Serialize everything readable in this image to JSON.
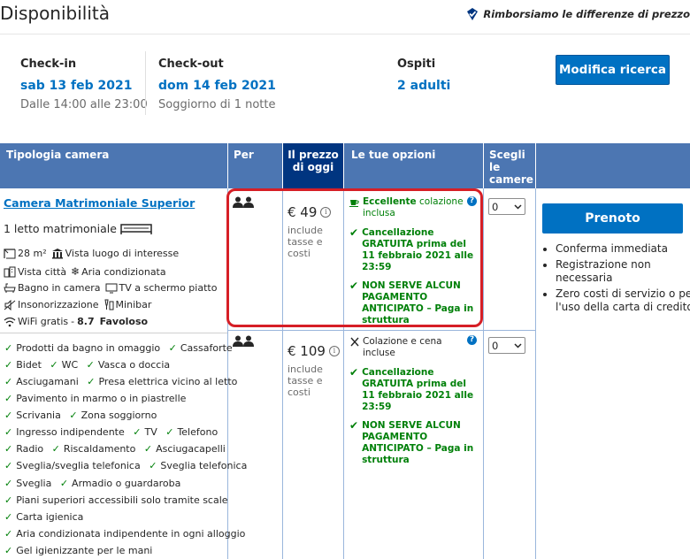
{
  "header": {
    "title": "Disponibilità",
    "promo": "Rimborsiamo le differenze di prezzo"
  },
  "stay": {
    "checkin_label": "Check-in",
    "checkin_date": "sab 13 feb 2021",
    "checkin_time": "Dalle 14:00 alle 23:00",
    "checkout_label": "Check-out",
    "checkout_date": "dom 14 feb 2021",
    "checkout_note": "Soggiorno di 1 notte",
    "guests_label": "Ospiti",
    "guests_value": "2 adulti",
    "modify_button": "Modifica ricerca"
  },
  "table": {
    "headers": {
      "type": "Tipologia camera",
      "per": "Per",
      "price_l1": "Il prezzo",
      "price_l2": "di oggi",
      "options": "Le tue opzioni",
      "choose_l1": "Scegli",
      "choose_l2": "le",
      "choose_l3": "camere"
    }
  },
  "room": {
    "name": "Camera Matrimoniale Superior",
    "bed": "1 letto matrimoniale",
    "facilities": {
      "size": "28 m²",
      "landmark_view": "Vista luogo di interesse",
      "city_view": "Vista città",
      "ac": "Aria condizionata",
      "bathroom": "Bagno in camera",
      "tv": "TV a schermo piatto",
      "soundproof": "Insonorizzazione",
      "minibar": "Minibar",
      "wifi": "WiFi gratis",
      "wifi_score": "8.7",
      "wifi_rating": "Favoloso"
    },
    "amenities": {
      "r1a": "Prodotti da bagno in omaggio",
      "r1b": "Cassaforte",
      "r2a": "Bidet",
      "r2b": "WC",
      "r2c": "Vasca o doccia",
      "r3a": "Asciugamani",
      "r3b": "Presa elettrica vicino al letto",
      "r4a": "Pavimento in marmo o in piastrelle",
      "r5a": "Scrivania",
      "r5b": "Zona soggiorno",
      "r6a": "Ingresso indipendente",
      "r6b": "TV",
      "r6c": "Telefono",
      "r7a": "Radio",
      "r7b": "Riscaldamento",
      "r7c": "Asciugacapelli",
      "r8a": "Sveglia/sveglia telefonica",
      "r8b": "Sveglia telefonica",
      "r9a": "Sveglia",
      "r9b": "Armadio o guardaroba",
      "r10a": "Piani superiori accessibili solo tramite scale",
      "r11a": "Carta igienica",
      "r12a": "Aria condizionata indipendente in ogni alloggio",
      "r13a": "Gel igienizzante per le mani"
    }
  },
  "offers": [
    {
      "price": "€ 49",
      "note_l1": "include",
      "note_l2": "tasse e",
      "note_l3": "costi",
      "meal_bold": "Eccellente",
      "meal_rest": " colazione",
      "meal_l2": "inclusa",
      "cancel_l1": "Cancellazione",
      "cancel_l2": "GRATUITA prima del",
      "cancel_l3": "11 febbraio 2021 alle",
      "cancel_l4": "23:59",
      "prepay_l1": "NON SERVE ALCUN",
      "prepay_l2": "PAGAMENTO",
      "prepay_l3": "ANTICIPATO – Paga in",
      "prepay_l4": "struttura",
      "qty": "0"
    },
    {
      "price": "€ 109",
      "note_l1": "include",
      "note_l2": "tasse e",
      "note_l3": "costi",
      "meal_l1": "Colazione e cena",
      "meal_l2": "incluse",
      "cancel_l1": "Cancellazione",
      "cancel_l2": "GRATUITA prima del",
      "cancel_l3": "11 febbraio 2021 alle",
      "cancel_l4": "23:59",
      "prepay_l1": "NON SERVE ALCUN",
      "prepay_l2": "PAGAMENTO",
      "prepay_l3": "ANTICIPATO – Paga in",
      "prepay_l4": "struttura",
      "qty": "0"
    }
  ],
  "booking": {
    "button": "Prenoto",
    "benefits": [
      "Conferma immediata",
      "Registrazione non necessaria",
      "Zero costi di servizio o per l'uso della carta di credito"
    ]
  },
  "colors": {
    "accent": "#0071c2",
    "header_bg": "#4c76b2",
    "header_dark": "#003580",
    "green": "#008009",
    "highlight": "#d61f26"
  }
}
